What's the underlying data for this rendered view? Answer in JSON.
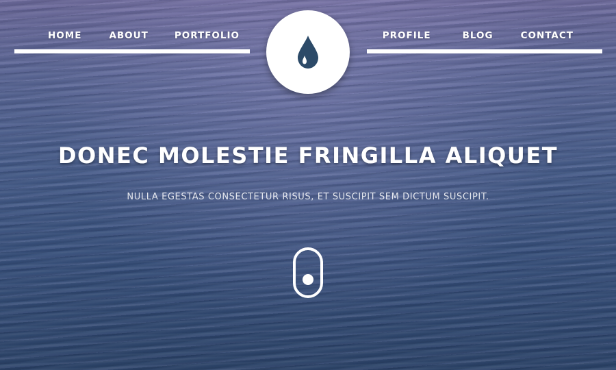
{
  "nav": {
    "left": [
      {
        "label": "HOME"
      },
      {
        "label": "ABOUT"
      },
      {
        "label": "PORTFOLIO"
      }
    ],
    "right": [
      {
        "label": "PROFILE"
      },
      {
        "label": "BLOG"
      },
      {
        "label": "CONTACT"
      }
    ]
  },
  "logo": {
    "icon": "water-drop-icon",
    "icon_color": "#2c4a68"
  },
  "hero": {
    "headline": "DONEC MOLESTIE FRINGILLA ALIQUET",
    "subline": "NULLA EGESTAS CONSECTETUR RISUS, ET SUSCIPIT SEM DICTUM SUSCIPIT.",
    "scroll_icon": "mouse-scroll-icon"
  },
  "colors": {
    "text": "#ffffff",
    "ocean": "#3f557f",
    "rule": "#ffffff"
  }
}
